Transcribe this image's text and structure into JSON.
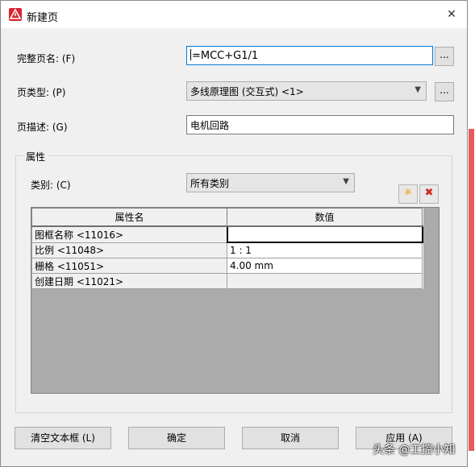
{
  "window": {
    "title": "新建页",
    "close_icon": "close-icon"
  },
  "fields": {
    "full_page_name": {
      "label": "完整页名: (F)",
      "value": "=MCC+G1/1",
      "browse_label": "..."
    },
    "page_type": {
      "label": "页类型: (P)",
      "value": "多线原理图 (交互式) <1>",
      "browse_label": "..."
    },
    "page_description": {
      "label": "页描述: (G)",
      "value": "电机回路"
    }
  },
  "properties": {
    "group_label": "属性",
    "category": {
      "label": "类别: (C)",
      "value": "所有类别"
    },
    "new_icon": "new-star-icon",
    "delete_icon": "delete-x-icon",
    "columns": [
      "属性名",
      "数值"
    ],
    "rows": [
      {
        "name": "图框名称 <11016>",
        "value": ""
      },
      {
        "name": "比例 <11048>",
        "value": "1 : 1"
      },
      {
        "name": "栅格 <11051>",
        "value": "4.00 mm"
      },
      {
        "name": "创建日期 <11021>",
        "value": ""
      }
    ]
  },
  "buttons": {
    "clear": "清空文本框 (L)",
    "ok": "确定",
    "cancel": "取消",
    "apply": "应用 (A)"
  },
  "watermark": "头条 @工控小知",
  "colors": {
    "accent": "#0078d7",
    "app_icon": "#d9232d",
    "delete": "#d42a1e",
    "new": "#f0a000"
  }
}
